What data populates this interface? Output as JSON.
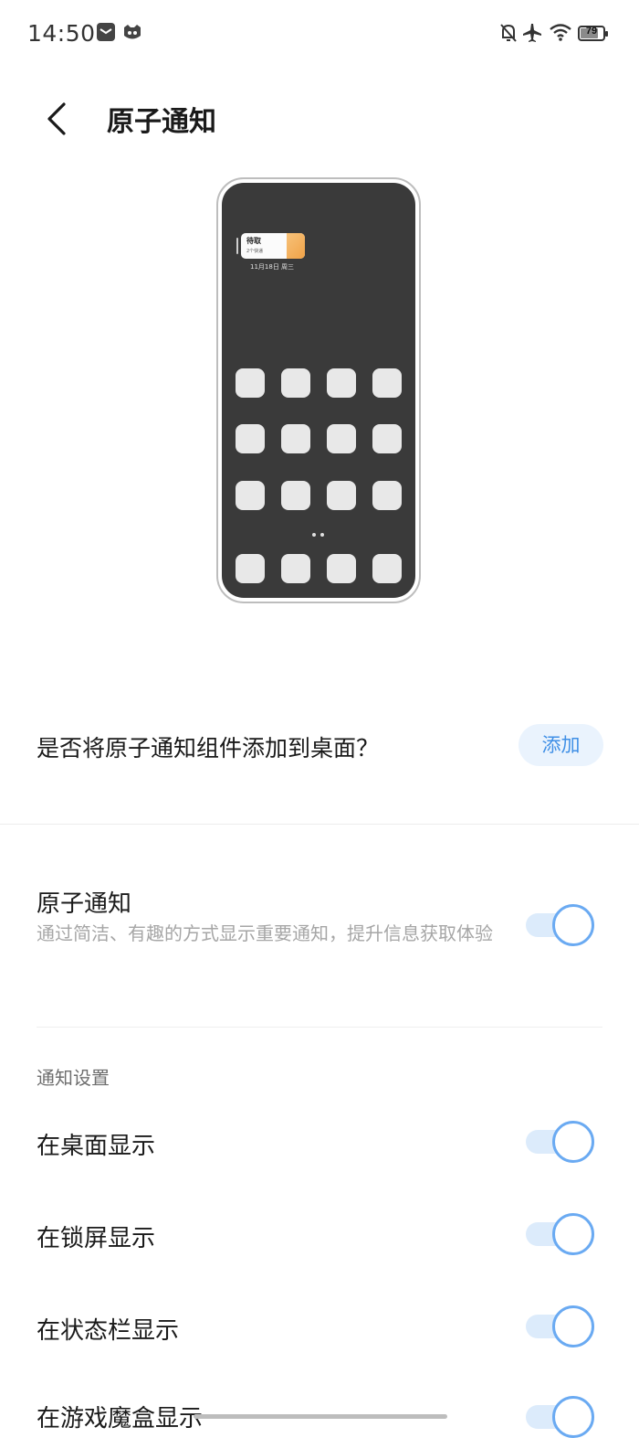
{
  "status_bar": {
    "time": "14:50",
    "battery": "79",
    "battery_fraction": 0.79,
    "icons": [
      "mail-icon",
      "cat-app-icon",
      "silent-bell-icon",
      "airplane-icon",
      "wifi-icon",
      "battery-icon"
    ]
  },
  "header": {
    "title": "原子通知",
    "back_icon": "chevron-left-icon"
  },
  "preview": {
    "widget_title": "待取",
    "widget_subtitle": "2个快递",
    "date": "11月18日 周三"
  },
  "add_widget": {
    "question": "是否将原子通知组件添加到桌面？",
    "button_label": "添加"
  },
  "atomic_notification": {
    "title": "原子通知",
    "description": "通过简洁、有趣的方式显示重要通知，提升信息获取体验",
    "enabled": true
  },
  "notification_settings": {
    "header": "通知设置",
    "items": [
      {
        "label": "在桌面显示",
        "enabled": true
      },
      {
        "label": "在锁屏显示",
        "enabled": true
      },
      {
        "label": "在状态栏显示",
        "enabled": true
      },
      {
        "label": "在游戏魔盒显示",
        "enabled": true
      }
    ]
  },
  "colors": {
    "accent": "#3f8fe6",
    "toggle_track": "#dcebfb",
    "toggle_knob_border": "#6aaaf2",
    "phone_screen": "#3a3a3a"
  }
}
